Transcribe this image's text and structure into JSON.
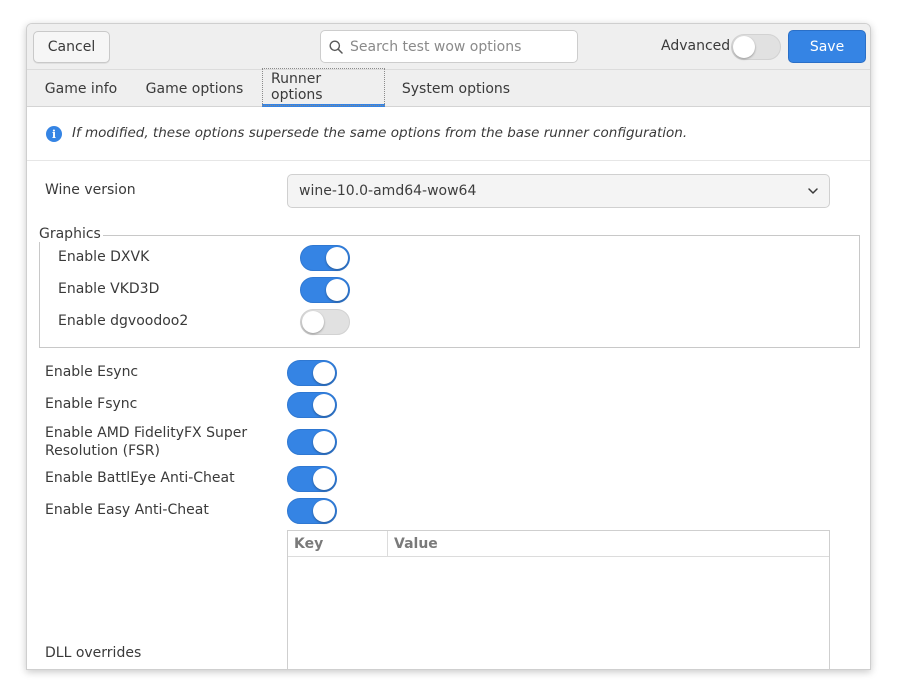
{
  "header": {
    "cancel_label": "Cancel",
    "search_placeholder": "Search test wow options",
    "advanced_label": "Advanced",
    "advanced_on": false,
    "save_label": "Save"
  },
  "tabs": [
    {
      "label": "Game info",
      "active": false
    },
    {
      "label": "Game options",
      "active": false
    },
    {
      "label": "Runner options",
      "active": true
    },
    {
      "label": "System options",
      "active": false
    }
  ],
  "info": {
    "icon": "info-icon",
    "text": "If modified, these options supersede the same options from the base runner configuration."
  },
  "wine_version": {
    "label": "Wine version",
    "value": "wine-10.0-amd64-wow64"
  },
  "graphics": {
    "title": "Graphics",
    "options": [
      {
        "label": "Enable DXVK",
        "on": true
      },
      {
        "label": "Enable VKD3D",
        "on": true
      },
      {
        "label": "Enable dgvoodoo2",
        "on": false
      }
    ]
  },
  "options": [
    {
      "label": "Enable Esync",
      "on": true
    },
    {
      "label": "Enable Fsync",
      "on": true
    },
    {
      "label": "Enable AMD FidelityFX Super Resolution (FSR)",
      "on": true
    },
    {
      "label": "Enable BattlEye Anti-Cheat",
      "on": true
    },
    {
      "label": "Enable Easy Anti-Cheat",
      "on": true
    }
  ],
  "dll_overrides": {
    "label": "DLL overrides",
    "columns": [
      "Key",
      "Value"
    ]
  },
  "colors": {
    "accent": "#3584e4",
    "headerbar": "#efefef"
  }
}
